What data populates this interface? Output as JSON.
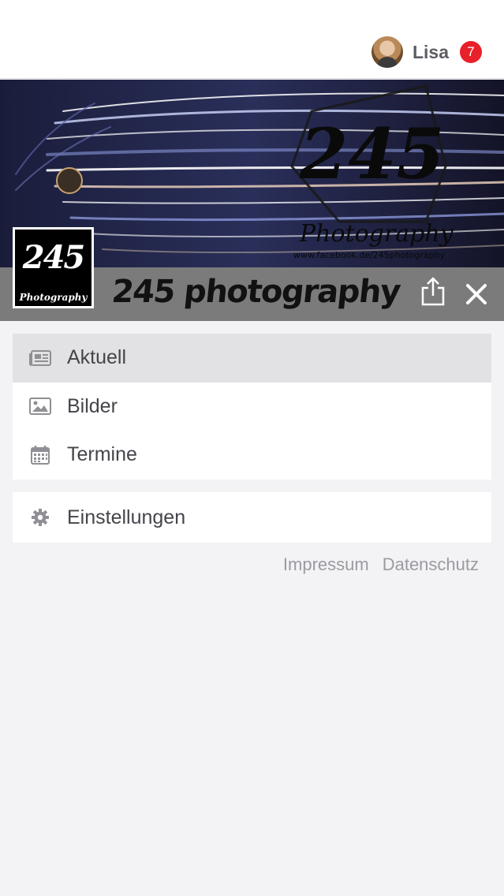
{
  "header": {
    "user_name": "Lisa",
    "notification_count": "7"
  },
  "hero": {
    "logo_number": "245",
    "logo_subtitle": "Photography",
    "title": "245 photography",
    "banner_text": "245",
    "banner_subtitle": "Photography",
    "banner_url": "www.facebook.de/245photography"
  },
  "menu": {
    "items": [
      {
        "label": "Aktuell",
        "icon": "newspaper-icon",
        "active": true
      },
      {
        "label": "Bilder",
        "icon": "image-icon",
        "active": false
      },
      {
        "label": "Termine",
        "icon": "calendar-icon",
        "active": false
      }
    ],
    "settings_label": "Einstellungen"
  },
  "footer": {
    "impressum": "Impressum",
    "datenschutz": "Datenschutz"
  },
  "colors": {
    "badge": "#e8202a",
    "title_bar": "#7b7b7b",
    "active_item": "#e2e2e4",
    "background": "#f3f3f6"
  }
}
